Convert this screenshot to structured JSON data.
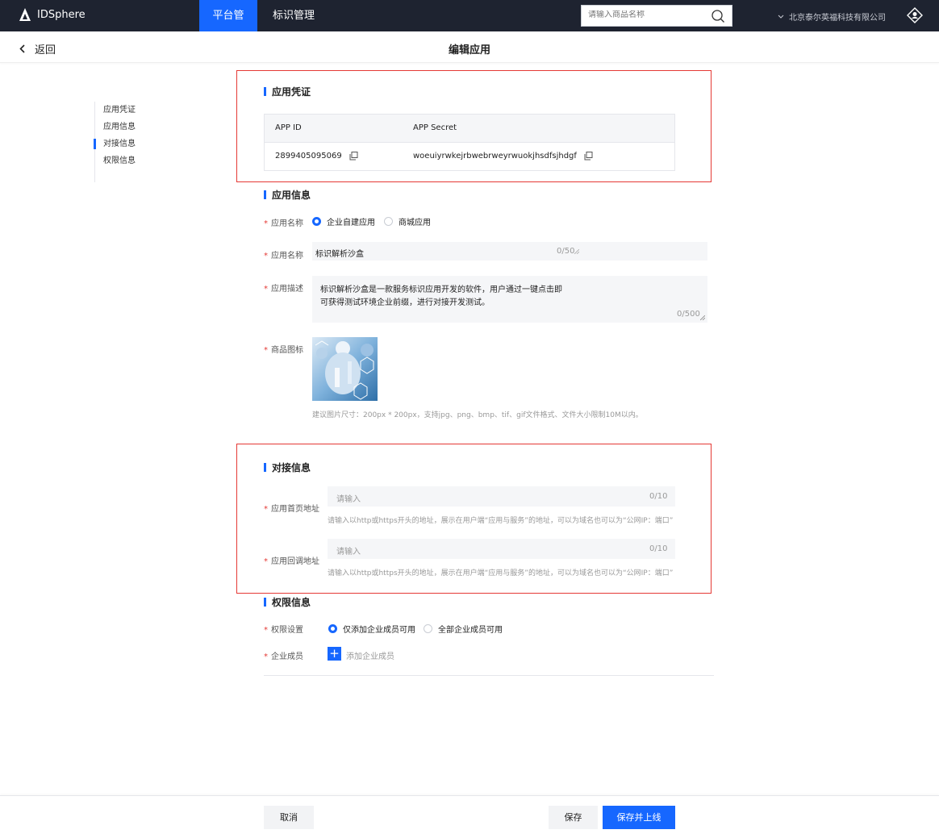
{
  "topbar": {
    "app_name": "IDSphere",
    "tabs": [
      "平台管理",
      "标识管理"
    ],
    "search_placeholder": "请输入商品名称",
    "company": "北京泰尔英福科技有限公司"
  },
  "subheader": {
    "back_label": "返回",
    "title": "编辑应用"
  },
  "side_nav": [
    "应用凭证",
    "应用信息",
    "对接信息",
    "权限信息"
  ],
  "credentials": {
    "title": "应用凭证",
    "head_app_id": "APP ID",
    "head_app_secret": "APP Secret",
    "app_id": "2899405095069",
    "app_secret": "woeuiyrwkejrbwebrweyrwuokjhsdfsjhdgf"
  },
  "app_info": {
    "title": "应用信息",
    "type_label": "应用名称",
    "type_options": [
      "企业自建应用",
      "商城应用"
    ],
    "type_selected": 0,
    "name_label": "应用名称",
    "name_value": "标识解析沙盒",
    "name_counter": "0/50",
    "desc_label": "应用描述",
    "desc_line1": "标识解析沙盒是一款服务标识应用开发的软件，用户通过一键点击即",
    "desc_line2": "可获得测试环境企业前缀，进行对接开发测试。",
    "desc_counter": "0/500",
    "icon_label": "商品图标",
    "icon_hint": "建议图片尺寸：200px * 200px，支持jpg、png、bmp、tif、gif文件格式、文件大小限制10M以内。"
  },
  "integration": {
    "title": "对接信息",
    "home_label": "应用首页地址",
    "home_placeholder": "请输入",
    "home_counter": "0/10",
    "home_hint": "请输入以http或https开头的地址，展示在用户端“应用与服务”的地址，可以为域名也可以为“公网IP：端口”",
    "callback_label": "应用回调地址",
    "callback_placeholder": "请输入",
    "callback_counter": "0/10",
    "callback_hint": "请输入以http或https开头的地址，展示在用户端“应用与服务”的地址，可以为域名也可以为“公网IP：端口”"
  },
  "permissions": {
    "title": "权限信息",
    "setting_label": "权限设置",
    "setting_options": [
      "仅添加企业成员可用",
      "全部企业成员可用"
    ],
    "setting_selected": 0,
    "member_label": "企业成员",
    "add_member_label": "添加企业成员"
  },
  "footer": {
    "cancel": "取消",
    "save": "保存",
    "save_publish": "保存并上线"
  },
  "colors": {
    "accent": "#1667ff",
    "topbar": "#1e2330",
    "required": "#e53935",
    "highlight_box": "#e53935"
  }
}
